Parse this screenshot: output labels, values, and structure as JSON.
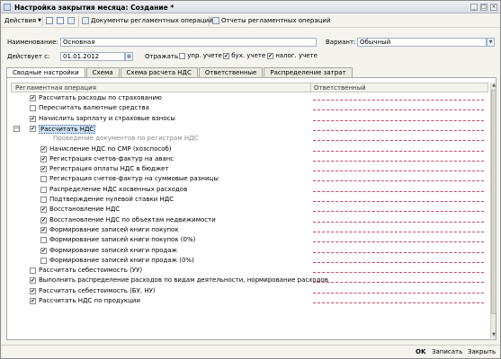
{
  "window": {
    "title": "Настройка закрытия месяца: Создание *",
    "buttons": [
      "_",
      "□",
      "×"
    ]
  },
  "toolbar": {
    "actions_label": "Действия",
    "docs_label": "Документы регламентных операций",
    "reports_label": "Отчеты регламентных операций"
  },
  "form": {
    "name_label": "Наименование:",
    "name_value": "Основная",
    "variant_label": "Вариант:",
    "variant_value": "Обычный",
    "date_label": "Действует с:",
    "date_value": "01.01.2012",
    "reflect_label": "Отражать в:",
    "upr_label": "упр. учете",
    "upr_checked": false,
    "buh_label": "бух. учете",
    "buh_checked": true,
    "tax_label": "налог. учете",
    "tax_checked": true
  },
  "tabs": [
    {
      "label": "Сводные настройки",
      "active": true
    },
    {
      "label": "Схема",
      "active": false
    },
    {
      "label": "Схема расчета НДС",
      "active": false
    },
    {
      "label": "Ответственные",
      "active": false
    },
    {
      "label": "Распределение затрат",
      "active": false
    }
  ],
  "grid": {
    "col_operation": "Регламентная операция",
    "col_responsible": "Ответственный",
    "rows": [
      {
        "label": "Рассчитать расходы по страхованию",
        "checked": true,
        "level": 0
      },
      {
        "label": "Пересчитать валютные средства",
        "checked": false,
        "level": 0
      },
      {
        "label": "Начислить зарплату и страховые взносы",
        "checked": true,
        "level": 0
      },
      {
        "label": "Рассчитать НДС",
        "checked": true,
        "level": 0,
        "group": true,
        "selected": true
      },
      {
        "label": "Проведение документов по регистрам НДС",
        "checked": false,
        "level": 1,
        "dim": true,
        "nocheck": true
      },
      {
        "label": "Начисление НДС по СМР (хозспособ)",
        "checked": true,
        "level": 1
      },
      {
        "label": "Регистрация счетов-фактур на аванс",
        "checked": true,
        "level": 1
      },
      {
        "label": "Регистрация оплаты НДС в бюджет",
        "checked": true,
        "level": 1
      },
      {
        "label": "Регистрация счетов-фактур на суммовые разницы",
        "checked": false,
        "level": 1
      },
      {
        "label": "Распределение НДС косвенных расходов",
        "checked": false,
        "level": 1
      },
      {
        "label": "Подтверждение нулевой ставки НДС",
        "checked": false,
        "level": 1
      },
      {
        "label": "Восстановление НДС",
        "checked": true,
        "level": 1
      },
      {
        "label": "Восстановление НДС по объектам недвижимости",
        "checked": true,
        "level": 1
      },
      {
        "label": "Формирование записей книги покупок",
        "checked": true,
        "level": 1
      },
      {
        "label": "Формирование записей книги покупок (0%)",
        "checked": false,
        "level": 1
      },
      {
        "label": "Формирование записей книги продаж",
        "checked": true,
        "level": 1
      },
      {
        "label": "Формирование записей книги продаж (0%)",
        "checked": false,
        "level": 1
      },
      {
        "label": "Рассчитать себестоимость (УУ)",
        "checked": false,
        "level": 0
      },
      {
        "label": "Выполнить распределение расходов по видам деятельности, нормирование расходов",
        "checked": true,
        "level": 0
      },
      {
        "label": "Рассчитать себестоимость (БУ, НУ)",
        "checked": true,
        "level": 0
      },
      {
        "label": "Рассчитать НДС по продукции",
        "checked": true,
        "level": 0
      }
    ]
  },
  "bottom": {
    "ok_label": "OK",
    "save_label": "Записать",
    "close_label": "Закрыть"
  }
}
